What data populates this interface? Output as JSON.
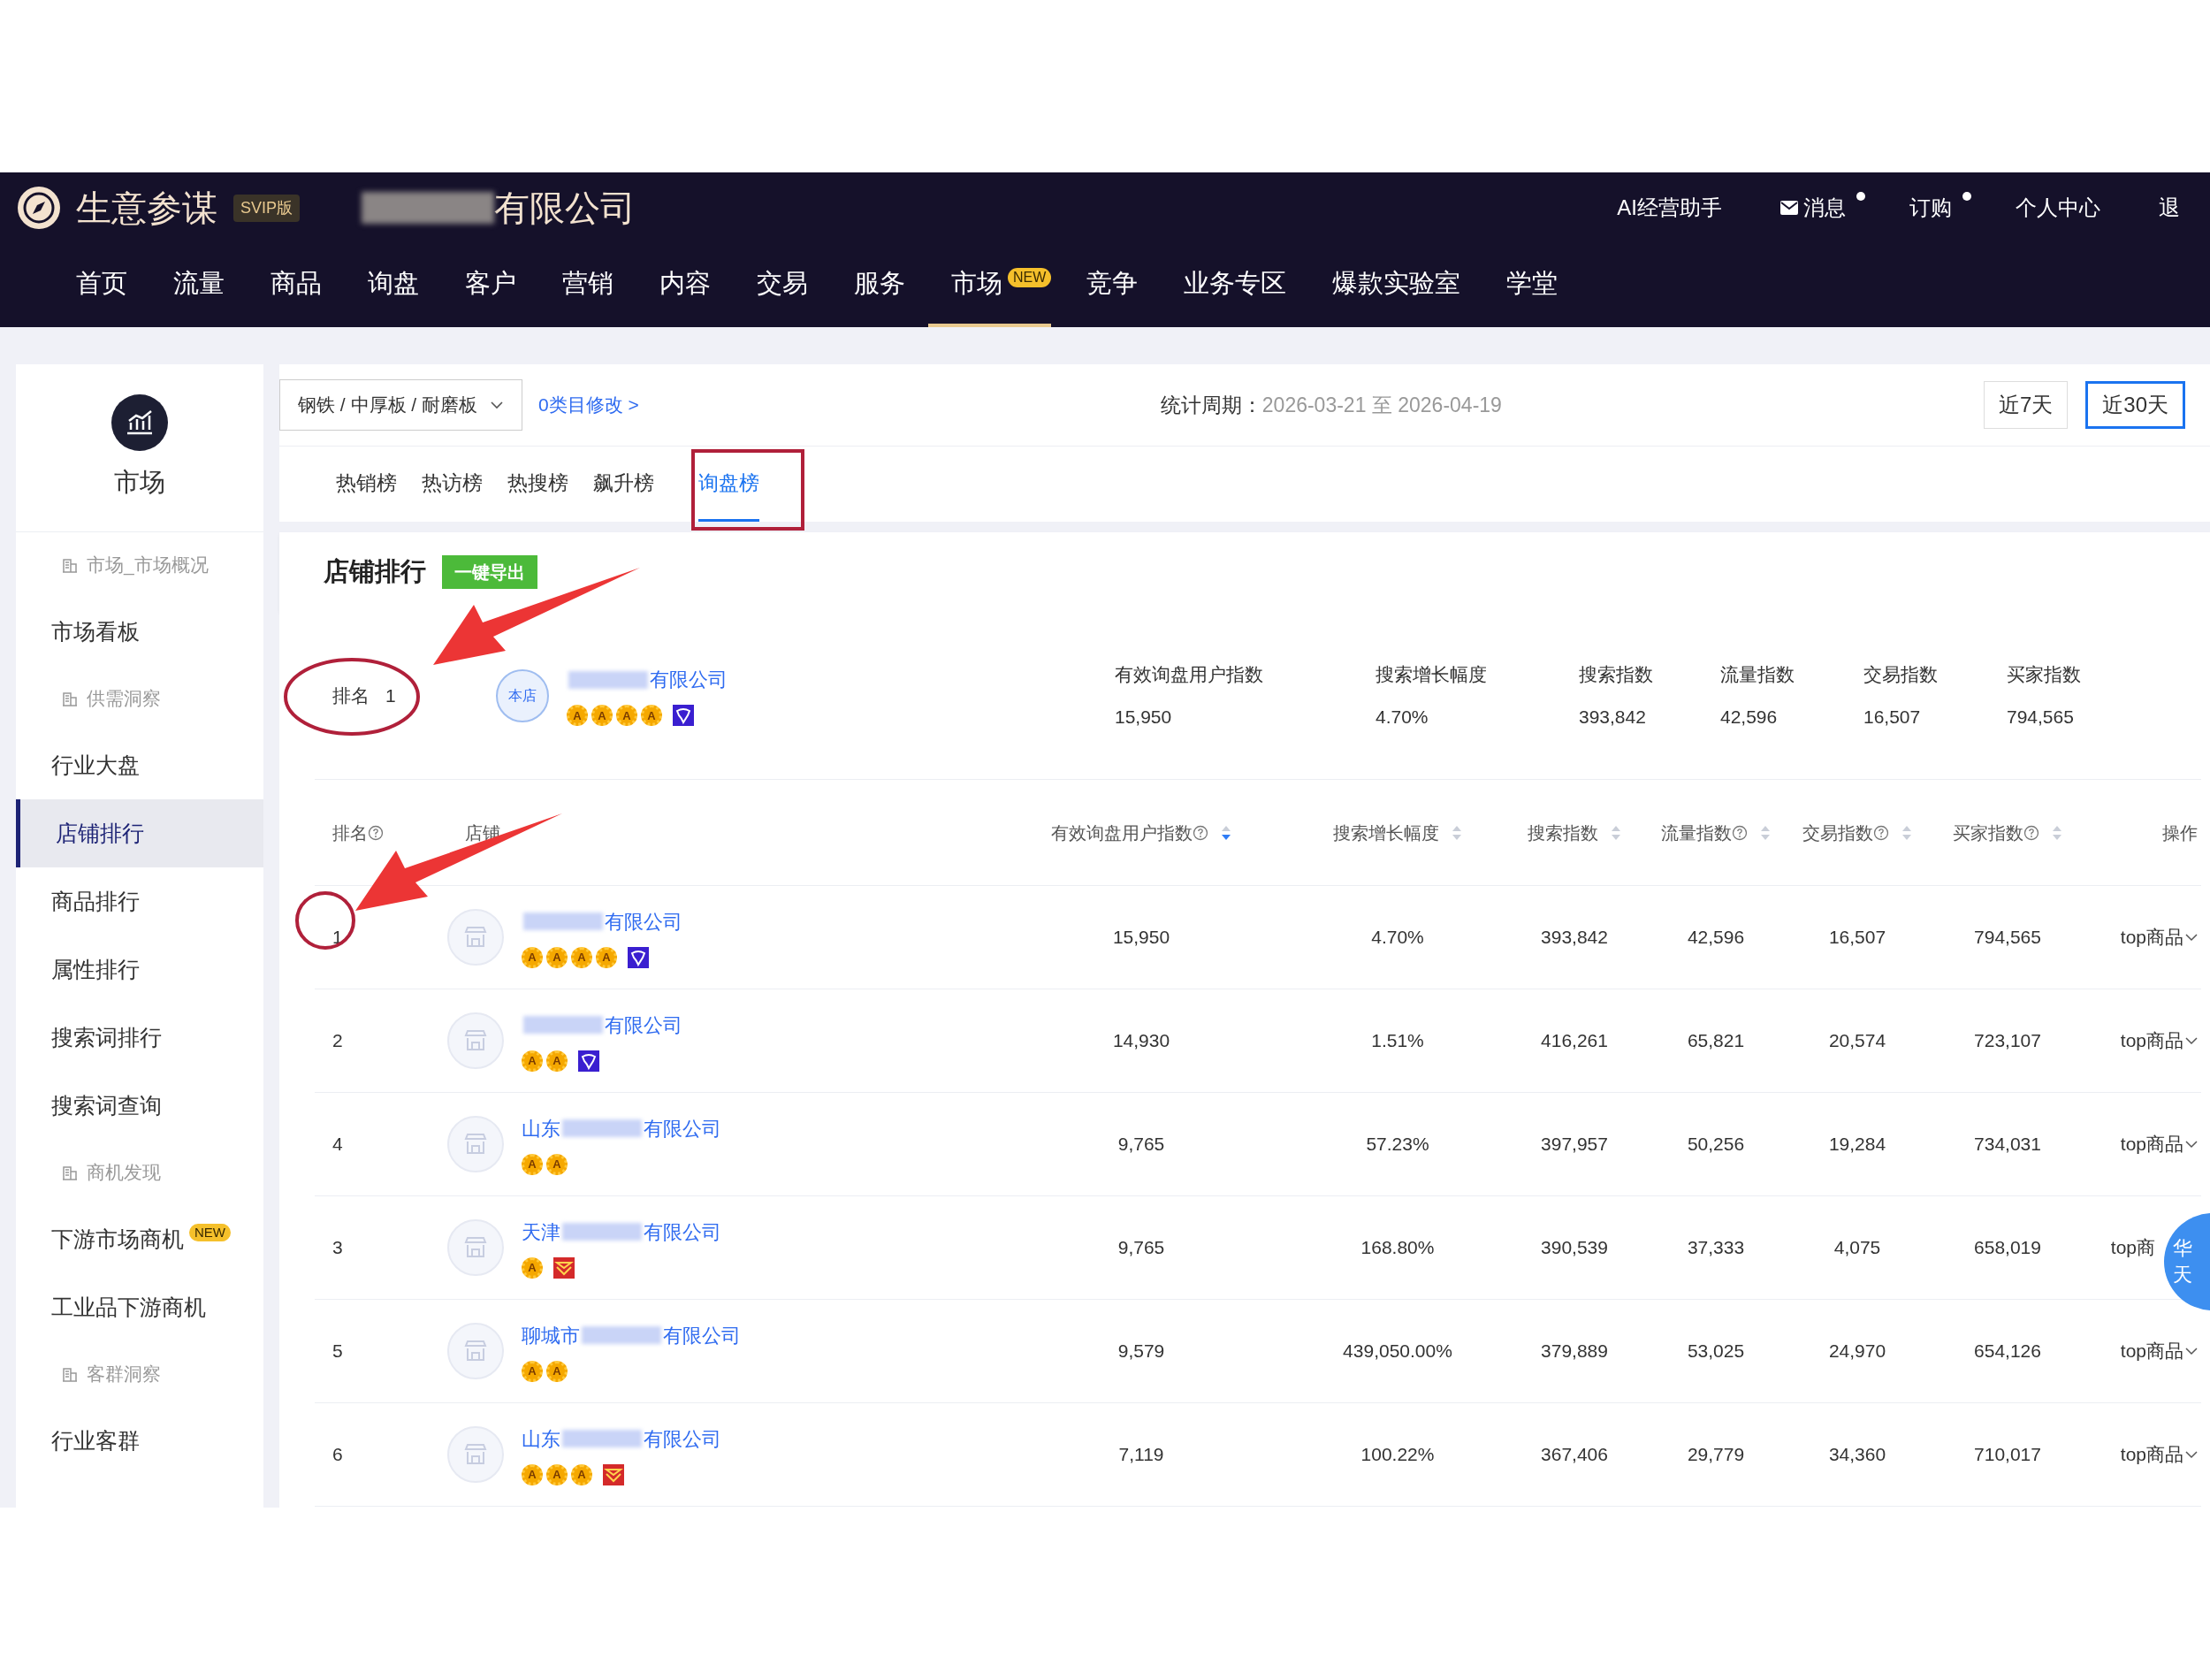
{
  "header": {
    "brand": "生意参谋",
    "edition": "SVIP版",
    "company_suffix": "有限公司",
    "links": [
      {
        "label": "AI经营助手",
        "kind": "plain",
        "dot": false
      },
      {
        "label": "消息",
        "kind": "mail",
        "dot": true
      },
      {
        "label": "订购",
        "kind": "plain",
        "dot": true
      },
      {
        "label": "个人中心",
        "kind": "plain",
        "dot": false
      },
      {
        "label": "退",
        "kind": "plain",
        "dot": false
      }
    ]
  },
  "nav": [
    {
      "label": "首页",
      "selected": false
    },
    {
      "label": "流量",
      "selected": false
    },
    {
      "label": "商品",
      "selected": false
    },
    {
      "label": "询盘",
      "selected": false
    },
    {
      "label": "客户",
      "selected": false
    },
    {
      "label": "营销",
      "selected": false
    },
    {
      "label": "内容",
      "selected": false
    },
    {
      "label": "交易",
      "selected": false
    },
    {
      "label": "服务",
      "selected": false
    },
    {
      "label": "市场",
      "selected": true,
      "badge": "NEW"
    },
    {
      "label": "竞争",
      "selected": false
    },
    {
      "label": "业务专区",
      "selected": false
    },
    {
      "label": "爆款实验室",
      "selected": false
    },
    {
      "label": "学堂",
      "selected": false
    }
  ],
  "sidebar": {
    "title": "市场",
    "items": [
      {
        "kind": "group",
        "label": "市场_市场概况",
        "selected": false
      },
      {
        "kind": "item",
        "label": "市场看板",
        "selected": false
      },
      {
        "kind": "group",
        "label": "供需洞察",
        "selected": false
      },
      {
        "kind": "item",
        "label": "行业大盘",
        "selected": false
      },
      {
        "kind": "item",
        "label": "店铺排行",
        "selected": true
      },
      {
        "kind": "item",
        "label": "商品排行",
        "selected": false
      },
      {
        "kind": "item",
        "label": "属性排行",
        "selected": false
      },
      {
        "kind": "item",
        "label": "搜索词排行",
        "selected": false
      },
      {
        "kind": "item",
        "label": "搜索词查询",
        "selected": false
      },
      {
        "kind": "group",
        "label": "商机发现",
        "selected": false
      },
      {
        "kind": "item",
        "label": "下游市场商机",
        "selected": false,
        "badge": "NEW"
      },
      {
        "kind": "item",
        "label": "工业品下游商机",
        "selected": false
      },
      {
        "kind": "group",
        "label": "客群洞察",
        "selected": false
      },
      {
        "kind": "item",
        "label": "行业客群",
        "selected": false
      }
    ]
  },
  "filter": {
    "category": "钢铁 / 中厚板 / 耐磨板",
    "edit_link": "0类目修改 >",
    "period_label": "统计周期：",
    "period_value": "2026-03-21 至 2026-04-19",
    "ranges": [
      {
        "label": "近7天",
        "selected": false
      },
      {
        "label": "近30天",
        "selected": true
      }
    ]
  },
  "tabs": [
    {
      "label": "热销榜",
      "selected": false
    },
    {
      "label": "热访榜",
      "selected": false
    },
    {
      "label": "热搜榜",
      "selected": false
    },
    {
      "label": "飙升榜",
      "selected": false
    },
    {
      "label": "询盘榜",
      "selected": true
    }
  ],
  "section": {
    "title": "店铺排行",
    "export_button": "一键导出"
  },
  "own_store": {
    "rank_label": "排名",
    "rank": "1",
    "avatar": "本店",
    "name_suffix": "有限公司",
    "medals": [
      "A",
      "A",
      "A",
      "A"
    ],
    "badge": {
      "kind": "member"
    },
    "metrics": [
      {
        "label": "有效询盘用户指数",
        "value": "15,950"
      },
      {
        "label": "搜索增长幅度",
        "value": "4.70%"
      },
      {
        "label": "搜索指数",
        "value": "393,842"
      },
      {
        "label": "流量指数",
        "value": "42,596"
      },
      {
        "label": "交易指数",
        "value": "16,507"
      },
      {
        "label": "买家指数",
        "value": "794,565"
      }
    ]
  },
  "table": {
    "columns": [
      {
        "label": "排名",
        "help": true,
        "sortable": false
      },
      {
        "label": "店铺",
        "help": false,
        "sortable": false
      },
      {
        "label": "有效询盘用户指数",
        "help": true,
        "sortable": true,
        "sorted": true
      },
      {
        "label": "搜索增长幅度",
        "help": false,
        "sortable": true,
        "sorted": false
      },
      {
        "label": "搜索指数",
        "help": false,
        "sortable": true,
        "sorted": false
      },
      {
        "label": "流量指数",
        "help": true,
        "sortable": true,
        "sorted": false
      },
      {
        "label": "交易指数",
        "help": true,
        "sortable": true,
        "sorted": false
      },
      {
        "label": "买家指数",
        "help": true,
        "sortable": true,
        "sorted": false
      },
      {
        "label": "操作",
        "help": false,
        "sortable": false
      }
    ],
    "rows": [
      {
        "rank": "1",
        "name_suffix": "有限公司",
        "medals": [
          "A",
          "A",
          "A",
          "A"
        ],
        "badge": {
          "kind": "member"
        },
        "values": [
          "15,950",
          "4.70%",
          "393,842",
          "42,596",
          "16,507",
          "794,565"
        ],
        "action": "top商品",
        "chevron": true
      },
      {
        "rank": "2",
        "name_suffix": "有限公司",
        "medals": [
          "A",
          "A"
        ],
        "badge": {
          "kind": "member"
        },
        "values": [
          "14,930",
          "1.51%",
          "416,261",
          "65,821",
          "20,574",
          "723,107"
        ],
        "action": "top商品",
        "chevron": true
      },
      {
        "rank": "4",
        "name_prefix": "山东",
        "name_suffix": "有限公司",
        "medals": [
          "A",
          "A"
        ],
        "values": [
          "9,765",
          "57.23%",
          "397,957",
          "50,256",
          "19,284",
          "734,031"
        ],
        "action": "top商品",
        "chevron": true
      },
      {
        "rank": "3",
        "name_prefix": "天津",
        "name_suffix": "有限公司",
        "medals": [
          "A"
        ],
        "badge": {
          "kind": "trade"
        },
        "values": [
          "9,765",
          "168.80%",
          "390,539",
          "37,333",
          "4,075",
          "658,019"
        ],
        "action": "top商",
        "chevron": false
      },
      {
        "rank": "5",
        "name_prefix": "聊城市",
        "name_suffix": "有限公司",
        "medals": [
          "A",
          "A"
        ],
        "values": [
          "9,579",
          "439,050.00%",
          "379,889",
          "53,025",
          "24,970",
          "654,126"
        ],
        "action": "top商品",
        "chevron": true
      },
      {
        "rank": "6",
        "name_prefix": "山东",
        "name_suffix": "有限公司",
        "medals": [
          "A",
          "A",
          "A"
        ],
        "badge": {
          "kind": "trade"
        },
        "values": [
          "7,119",
          "100.22%",
          "367,406",
          "29,779",
          "34,360",
          "710,017"
        ],
        "action": "top商品",
        "chevron": true
      }
    ]
  },
  "float_widget": {
    "lines": [
      "华",
      "天"
    ]
  }
}
